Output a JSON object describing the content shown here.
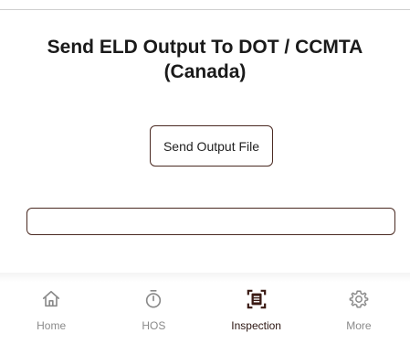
{
  "page": {
    "title_line1": "Send ELD Output To DOT / CCMTA",
    "title_line2": "(Canada)"
  },
  "actions": {
    "send_output_label": "Send Output File"
  },
  "output_field": {
    "value": "",
    "placeholder": ""
  },
  "bottom_nav": {
    "items": [
      {
        "label": "Home",
        "icon": "home-icon",
        "active": false
      },
      {
        "label": "HOS",
        "icon": "stopwatch-icon",
        "active": false
      },
      {
        "label": "Inspection",
        "icon": "inspection-scan-icon",
        "active": true
      },
      {
        "label": "More",
        "icon": "gear-icon",
        "active": false
      }
    ]
  },
  "colors": {
    "accent": "#4a2a22",
    "active_icon": "#3a1a14",
    "inactive_icon": "#8a8a8a"
  }
}
